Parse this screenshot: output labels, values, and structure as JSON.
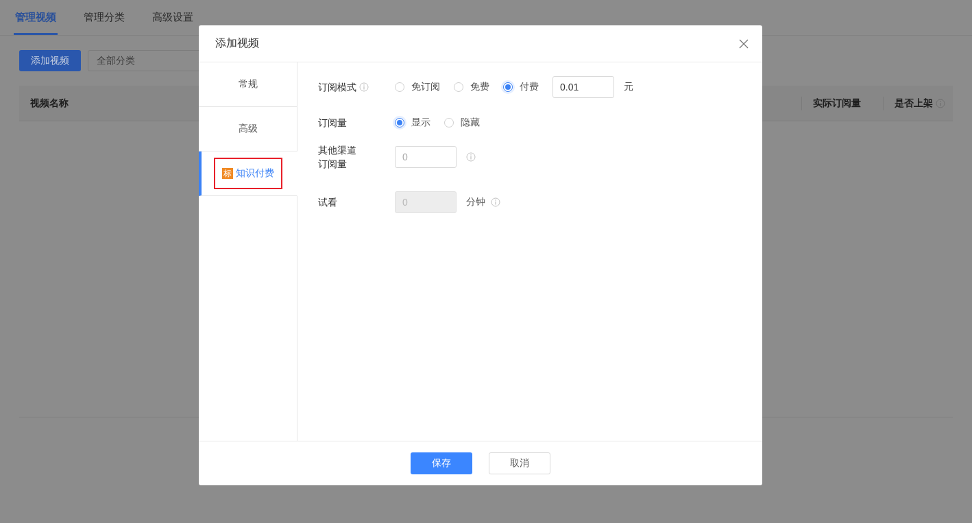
{
  "page_tabs": [
    {
      "label": "管理视频",
      "selected": true
    },
    {
      "label": "管理分类",
      "selected": false
    },
    {
      "label": "高级设置",
      "selected": false
    }
  ],
  "toolbar": {
    "add_button": "添加视频",
    "category_select": {
      "value": "全部分类"
    }
  },
  "table": {
    "columns": [
      {
        "label": "视频名称",
        "info": false
      },
      {
        "label": "实际订阅量",
        "info": false
      },
      {
        "label": "是否上架",
        "info": true
      }
    ]
  },
  "dialog": {
    "title": "添加视频",
    "side_tabs": [
      {
        "label": "常规",
        "selected": false,
        "highlighted": false
      },
      {
        "label": "高级",
        "selected": false,
        "highlighted": false
      },
      {
        "label": "知识付费",
        "badge": "标",
        "selected": true,
        "highlighted": true
      }
    ],
    "form": [
      {
        "kind": "radio",
        "label": "订阅模式",
        "info": true,
        "options": [
          {
            "label": "免订阅",
            "selected": false
          },
          {
            "label": "免费",
            "selected": false
          },
          {
            "label": "付费",
            "selected": true
          }
        ],
        "input": {
          "value": "0.01",
          "disabled": false
        },
        "unit": "元"
      },
      {
        "kind": "radio",
        "label": "订阅量",
        "info": false,
        "options": [
          {
            "label": "显示",
            "selected": true
          },
          {
            "label": "隐藏",
            "selected": false
          }
        ]
      },
      {
        "kind": "input",
        "label": "其他渠道订阅量",
        "info": true,
        "input": {
          "placeholder": "0",
          "disabled": false
        }
      },
      {
        "kind": "input",
        "label": "试看",
        "info": true,
        "input": {
          "placeholder": "0",
          "disabled": true
        },
        "unit": "分钟"
      }
    ],
    "buttons": [
      {
        "label": "保存",
        "kind": "primary"
      },
      {
        "label": "取消",
        "kind": "default"
      }
    ]
  }
}
